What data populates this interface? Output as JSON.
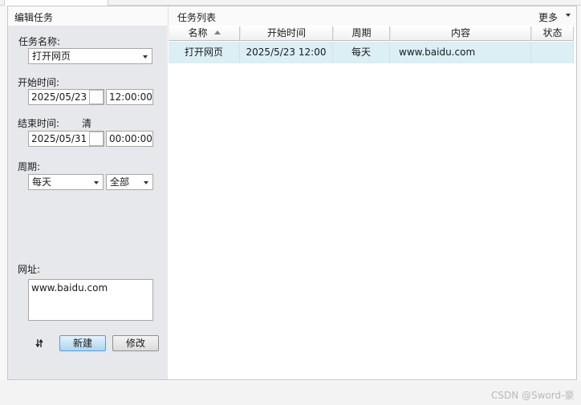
{
  "left_panel": {
    "header": "编辑任务",
    "task_name": {
      "label": "任务名称:",
      "value": "打开网页"
    },
    "start_time": {
      "label": "开始时间:",
      "date": "2025/05/23",
      "time": "12:00:00"
    },
    "end_time": {
      "label": "结束时间:",
      "clear_label": "清",
      "date": "2025/05/31",
      "time": "00:00:00"
    },
    "period": {
      "label": "周期:",
      "value": "每天",
      "scope_value": "全部"
    },
    "url": {
      "label": "网址:",
      "value": "www.baidu.com"
    },
    "buttons": {
      "new_label": "新建",
      "edit_label": "修改"
    }
  },
  "task_list": {
    "header": "任务列表",
    "more_label": "更多",
    "columns": [
      "名称",
      "开始时间",
      "周期",
      "内容",
      "状态"
    ],
    "rows": [
      {
        "name": "打开网页",
        "start": "2025/5/23 12:00",
        "period": "每天",
        "content": "www.baidu.com",
        "status": ""
      }
    ]
  },
  "watermark": "CSDN @Sword-豪",
  "colors": {
    "accent_button": "#a9d5f4",
    "selected_row": "#dbeff5",
    "left_panel_bg": "#e6e8eb"
  }
}
